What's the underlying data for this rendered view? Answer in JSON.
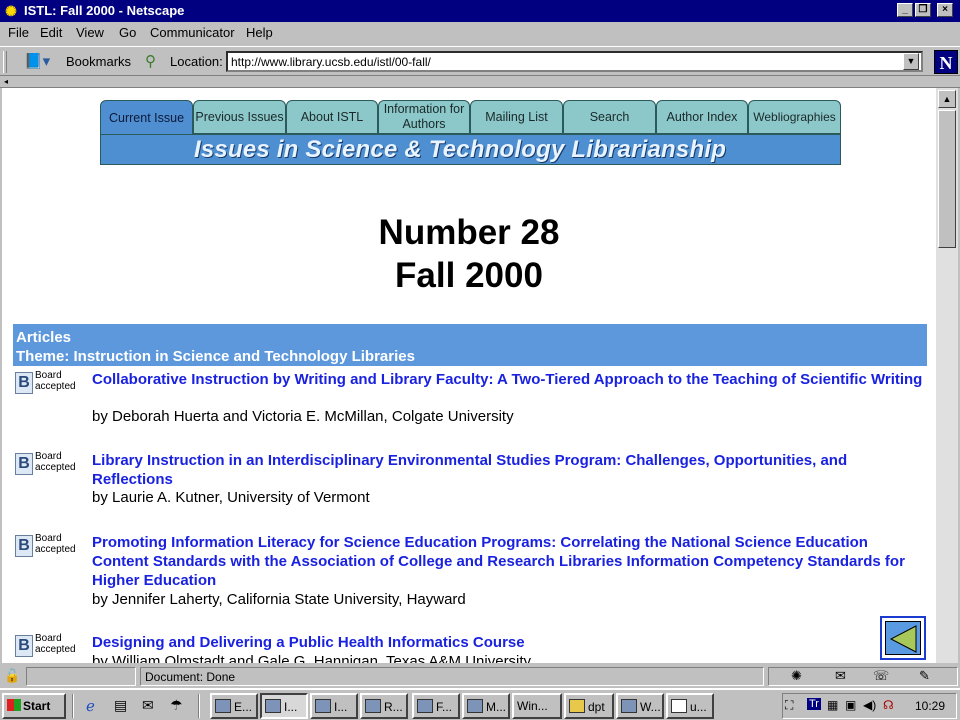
{
  "window": {
    "title": "ISTL: Fall 2000 - Netscape"
  },
  "menu": [
    "File",
    "Edit",
    "View",
    "Go",
    "Communicator",
    "Help"
  ],
  "toolbar": {
    "bookmarks": "Bookmarks",
    "location_label": "Location:",
    "url": "http://www.library.ucsb.edu/istl/00-fall/"
  },
  "nav_tabs": [
    {
      "label": "Current Issue"
    },
    {
      "label": "Previous Issues"
    },
    {
      "label": "About ISTL"
    },
    {
      "label": "Information for Authors"
    },
    {
      "label": "Mailing List"
    },
    {
      "label": "Search"
    },
    {
      "label": "Author Index"
    },
    {
      "label": "Webliographies"
    }
  ],
  "banner": "Issues in Science & Technology Librarianship",
  "heading": {
    "line1": "Number 28",
    "line2": "Fall 2000"
  },
  "section": {
    "line1": "Articles",
    "line2": "Theme: Instruction in Science and Technology Libraries"
  },
  "badge": {
    "letter": "B",
    "line1": "Board",
    "line2": "accepted"
  },
  "articles": [
    {
      "title": "Collaborative Instruction by Writing and Library Faculty: A Two-Tiered Approach to the Teaching of Scientific Writing",
      "by": "by Deborah Huerta and Victoria E. McMillan, Colgate University"
    },
    {
      "title": "Library Instruction in an Interdisciplinary Environmental Studies Program: Challenges, Opportunities, and Reflections",
      "by": "by Laurie A. Kutner, University of Vermont"
    },
    {
      "title": "Promoting Information Literacy for Science Education Programs: Correlating the National Science Education Content Standards with the Association of College and Research Libraries Information Competency Standards for Higher Education",
      "by": "by Jennifer Laherty, California State University, Hayward"
    },
    {
      "title": "Designing and Delivering a Public Health Informatics Course",
      "by": "by William Olmstadt and Gale G. Hannigan, Texas A&M University"
    }
  ],
  "status": {
    "text": "Document: Done"
  },
  "taskbar": {
    "start": "Start",
    "tasks": [
      "E...",
      "I...",
      "I...",
      "R...",
      "F...",
      "M...",
      "Win...",
      "dpt",
      "W...",
      "u..."
    ],
    "tray_tr": "Tr",
    "clock": "10:29"
  }
}
